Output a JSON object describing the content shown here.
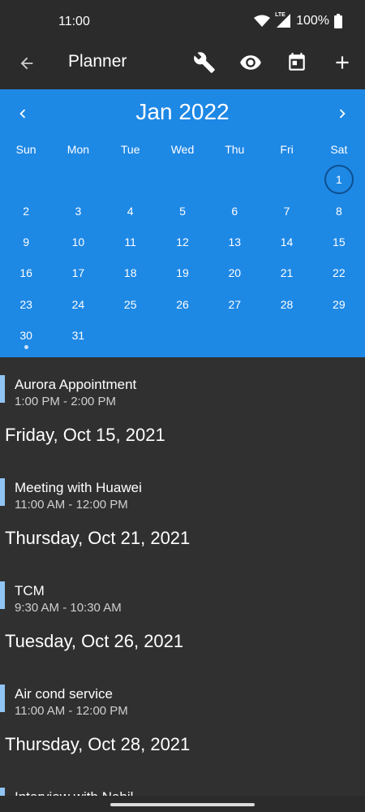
{
  "status_bar": {
    "time": "11:00",
    "network": "LTE",
    "battery": "100%"
  },
  "app_bar": {
    "title": "Planner",
    "icons": [
      "back-arrow-icon",
      "wrench-icon",
      "eye-icon",
      "calendar-icon",
      "plus-icon"
    ]
  },
  "calendar": {
    "month_label": "Jan 2022",
    "weekdays": [
      "Sun",
      "Mon",
      "Tue",
      "Wed",
      "Thu",
      "Fri",
      "Sat"
    ],
    "selected_day": "1",
    "days_with_events": [
      "30"
    ],
    "accent_color": "#1e88e5",
    "weeks": [
      [
        "",
        "",
        "",
        "",
        "",
        "",
        "1"
      ],
      [
        "2",
        "3",
        "4",
        "5",
        "6",
        "7",
        "8"
      ],
      [
        "9",
        "10",
        "11",
        "12",
        "13",
        "14",
        "15"
      ],
      [
        "16",
        "17",
        "18",
        "19",
        "20",
        "21",
        "22"
      ],
      [
        "23",
        "24",
        "25",
        "26",
        "27",
        "28",
        "29"
      ],
      [
        "30",
        "31",
        "",
        "",
        "",
        "",
        ""
      ]
    ]
  },
  "agenda": {
    "event_color": "#90c4f3",
    "items": [
      {
        "kind": "event",
        "title": "Aurora Appointment",
        "time": "1:00 PM - 2:00 PM"
      },
      {
        "kind": "header",
        "label": "Friday, Oct 15, 2021"
      },
      {
        "kind": "event",
        "title": "Meeting with Huawei",
        "time": "11:00 AM - 12:00 PM"
      },
      {
        "kind": "header",
        "label": "Thursday, Oct 21, 2021"
      },
      {
        "kind": "event",
        "title": "TCM",
        "time": "9:30 AM - 10:30 AM"
      },
      {
        "kind": "header",
        "label": "Tuesday, Oct 26, 2021"
      },
      {
        "kind": "event",
        "title": "Air cond service",
        "time": "11:00 AM - 12:00 PM"
      },
      {
        "kind": "header",
        "label": "Thursday, Oct 28, 2021"
      },
      {
        "kind": "event",
        "title": "Interview with Nabil",
        "time": ""
      }
    ]
  }
}
